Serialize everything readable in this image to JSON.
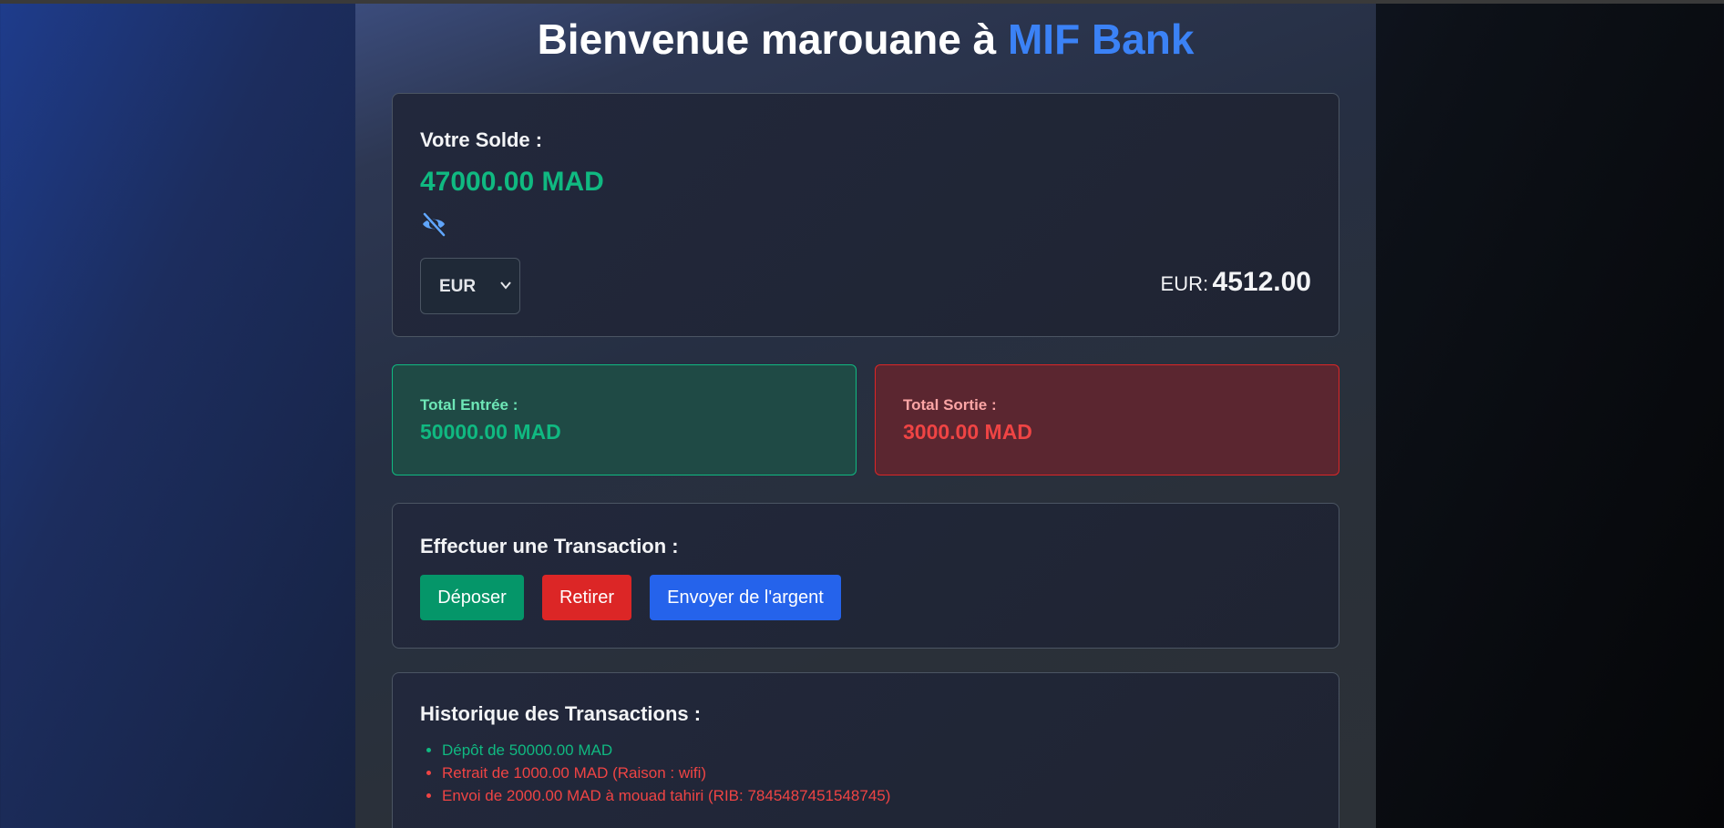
{
  "page": {
    "title_prefix": "Bienvenue marouane à ",
    "title_brand": "MIF Bank"
  },
  "balance": {
    "label": "Votre Solde :",
    "value": "47000.00 MAD",
    "toggle_icon": "eye-slash-icon",
    "currency_selected": "EUR",
    "converted_label": "EUR:",
    "converted_value": "4512.00"
  },
  "totals": {
    "in_label": "Total Entrée :",
    "in_value": "50000.00 MAD",
    "out_label": "Total Sortie :",
    "out_value": "3000.00 MAD"
  },
  "transaction": {
    "label": "Effectuer une Transaction :",
    "deposit_label": "Déposer",
    "withdraw_label": "Retirer",
    "send_label": "Envoyer de l'argent"
  },
  "history": {
    "label": "Historique des Transactions :",
    "items": [
      "Dépôt de 50000.00 MAD",
      "Retrait de 1000.00 MAD (Raison : wifi)",
      "Envoi de 2000.00 MAD à mouad tahiri (RIB: 7845487451548745)"
    ]
  },
  "colors": {
    "brand": "#3b82f6",
    "positive": "#10b981",
    "negative": "#ef4444",
    "deposit_button": "#059669",
    "withdraw_button": "#dc2626",
    "send_button": "#2563eb"
  }
}
